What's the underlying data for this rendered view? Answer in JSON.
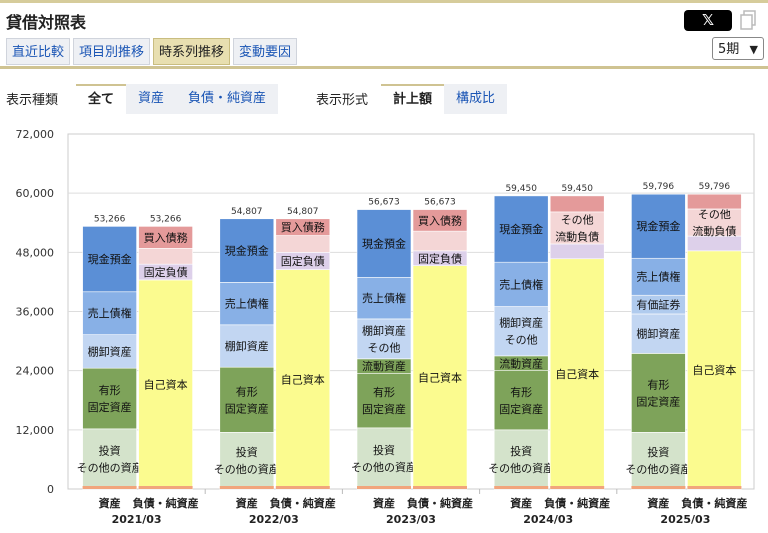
{
  "header": {
    "title": "貸借対照表",
    "share_icon": "x-logo-icon",
    "copy_icon": "copy-icon"
  },
  "tabs": [
    {
      "label": "直近比較",
      "active": false
    },
    {
      "label": "項目別推移",
      "active": false
    },
    {
      "label": "時系列推移",
      "active": true
    },
    {
      "label": "変動要因",
      "active": false
    }
  ],
  "period_select": {
    "value": "5期"
  },
  "display_type": {
    "label": "表示種類",
    "options": [
      {
        "label": "全て",
        "active": true
      },
      {
        "label": "資産",
        "active": false
      },
      {
        "label": "負債・純資産",
        "active": false
      }
    ]
  },
  "display_format": {
    "label": "表示形式",
    "options": [
      {
        "label": "計上額",
        "active": true
      },
      {
        "label": "構成比",
        "active": false
      }
    ]
  },
  "colors": {
    "cash": "#5b8fd6",
    "receivables": "#88b0e6",
    "inventory": "#c2d6f2",
    "current_other": "#d6e4f7",
    "securities": "#b0cbee",
    "tangible": "#7ea35a",
    "investments": "#d4e3cb",
    "payables": "#e49a9a",
    "other_current_liab": "#f4d6d6",
    "fixed_liab": "#ddd0ea",
    "equity": "#fbfb8f",
    "bottom": "#f1a57c"
  },
  "chart_data": {
    "type": "bar",
    "stacked": true,
    "ylim": [
      0,
      72000
    ],
    "yticks": [
      "0",
      "12,000",
      "24,000",
      "36,000",
      "48,000",
      "60,000",
      "72,000"
    ],
    "grid": true,
    "periods": [
      {
        "label": "2021/03",
        "assets": {
          "category": "資産",
          "total": "53,266",
          "segments": [
            {
              "lines": [
                "投資",
                "その他の資産"
              ],
              "value": 12200,
              "color": "investments"
            },
            {
              "lines": [
                "有形",
                "固定資産"
              ],
              "value": 12300,
              "color": "tangible"
            },
            {
              "lines": [
                "棚卸資産"
              ],
              "value": 6800,
              "color": "inventory"
            },
            {
              "lines": [
                "売上債権"
              ],
              "value": 8700,
              "color": "receivables"
            },
            {
              "lines": [
                "現金預金"
              ],
              "value": 13266,
              "color": "cash"
            }
          ]
        },
        "liabilities": {
          "category": "負債・純資産",
          "total": "53,266",
          "segments": [
            {
              "lines": [
                "自己資本"
              ],
              "value": 42400,
              "color": "equity"
            },
            {
              "lines": [
                "固定負債"
              ],
              "value": 3200,
              "color": "fixed_liab"
            },
            {
              "lines": [],
              "value": 3200,
              "color": "other_current_liab"
            },
            {
              "lines": [
                "買入債務"
              ],
              "value": 4466,
              "color": "payables"
            }
          ]
        }
      },
      {
        "label": "2022/03",
        "assets": {
          "category": "資産",
          "total": "54,807",
          "segments": [
            {
              "lines": [
                "投資",
                "その他の資産"
              ],
              "value": 11500,
              "color": "investments"
            },
            {
              "lines": [
                "有形",
                "固定資産"
              ],
              "value": 13200,
              "color": "tangible"
            },
            {
              "lines": [
                "棚卸資産"
              ],
              "value": 8600,
              "color": "inventory"
            },
            {
              "lines": [
                "売上債権"
              ],
              "value": 8600,
              "color": "receivables"
            },
            {
              "lines": [
                "現金預金"
              ],
              "value": 12907,
              "color": "cash"
            }
          ]
        },
        "liabilities": {
          "category": "負債・純資産",
          "total": "54,807",
          "segments": [
            {
              "lines": [
                "自己資本"
              ],
              "value": 44500,
              "color": "equity"
            },
            {
              "lines": [
                "固定負債"
              ],
              "value": 3500,
              "color": "fixed_liab"
            },
            {
              "lines": [],
              "value": 3400,
              "color": "other_current_liab"
            },
            {
              "lines": [
                "買入債務"
              ],
              "value": 3407,
              "color": "payables"
            }
          ]
        }
      },
      {
        "label": "2023/03",
        "assets": {
          "category": "資産",
          "total": "56,673",
          "segments": [
            {
              "lines": [
                "投資",
                "その他の資産"
              ],
              "value": 12400,
              "color": "investments"
            },
            {
              "lines": [
                "有形",
                "固定資産"
              ],
              "value": 11000,
              "color": "tangible"
            },
            {
              "lines": [
                "流動資産"
              ],
              "value": 3000,
              "color": "tangible"
            },
            {
              "lines": [
                "棚卸資産",
                "その他"
              ],
              "value": 8100,
              "color": "inventory"
            },
            {
              "lines": [
                "売上債権"
              ],
              "value": 8400,
              "color": "receivables"
            },
            {
              "lines": [
                "現金預金"
              ],
              "value": 13773,
              "color": "cash"
            }
          ]
        },
        "liabilities": {
          "category": "負債・純資産",
          "total": "56,673",
          "segments": [
            {
              "lines": [
                "自己資本"
              ],
              "value": 45300,
              "color": "equity"
            },
            {
              "lines": [
                "固定負債"
              ],
              "value": 3000,
              "color": "fixed_liab"
            },
            {
              "lines": [],
              "value": 4000,
              "color": "other_current_liab"
            },
            {
              "lines": [
                "買入債務"
              ],
              "value": 4373,
              "color": "payables"
            }
          ]
        }
      },
      {
        "label": "2024/03",
        "assets": {
          "category": "資産",
          "total": "59,450",
          "segments": [
            {
              "lines": [
                "投資",
                "その他の資産"
              ],
              "value": 12000,
              "color": "investments"
            },
            {
              "lines": [
                "有形",
                "固定資産"
              ],
              "value": 12000,
              "color": "tangible"
            },
            {
              "lines": [
                "流動資産"
              ],
              "value": 3000,
              "color": "tangible"
            },
            {
              "lines": [
                "棚卸資産",
                "その他"
              ],
              "value": 10000,
              "color": "inventory"
            },
            {
              "lines": [
                "売上債権"
              ],
              "value": 9000,
              "color": "receivables"
            },
            {
              "lines": [
                "現金預金"
              ],
              "value": 13450,
              "color": "cash"
            }
          ]
        },
        "liabilities": {
          "category": "負債・純資産",
          "total": "59,450",
          "segments": [
            {
              "lines": [
                "自己資本"
              ],
              "value": 46700,
              "color": "equity"
            },
            {
              "lines": [],
              "value": 3000,
              "color": "fixed_liab"
            },
            {
              "lines": [
                "その他",
                "流動負債"
              ],
              "value": 6500,
              "color": "other_current_liab"
            },
            {
              "lines": [],
              "value": 3250,
              "color": "payables"
            }
          ]
        }
      },
      {
        "label": "2025/03",
        "assets": {
          "category": "資産",
          "total": "59,796",
          "segments": [
            {
              "lines": [
                "投資",
                "その他の資産"
              ],
              "value": 11500,
              "color": "investments"
            },
            {
              "lines": [
                "有形",
                "固定資産"
              ],
              "value": 16000,
              "color": "tangible"
            },
            {
              "lines": [
                "棚卸資産"
              ],
              "value": 8000,
              "color": "inventory"
            },
            {
              "lines": [
                "有価証券"
              ],
              "value": 3800,
              "color": "securities"
            },
            {
              "lines": [
                "売上債権"
              ],
              "value": 7500,
              "color": "receivables"
            },
            {
              "lines": [
                "現金預金"
              ],
              "value": 12996,
              "color": "cash"
            }
          ]
        },
        "liabilities": {
          "category": "負債・純資産",
          "total": "59,796",
          "segments": [
            {
              "lines": [
                "自己資本"
              ],
              "value": 48300,
              "color": "equity"
            },
            {
              "lines": [],
              "value": 3000,
              "color": "fixed_liab"
            },
            {
              "lines": [
                "その他",
                "流動負債"
              ],
              "value": 5500,
              "color": "other_current_liab"
            },
            {
              "lines": [],
              "value": 2996,
              "color": "payables"
            }
          ]
        }
      }
    ]
  }
}
